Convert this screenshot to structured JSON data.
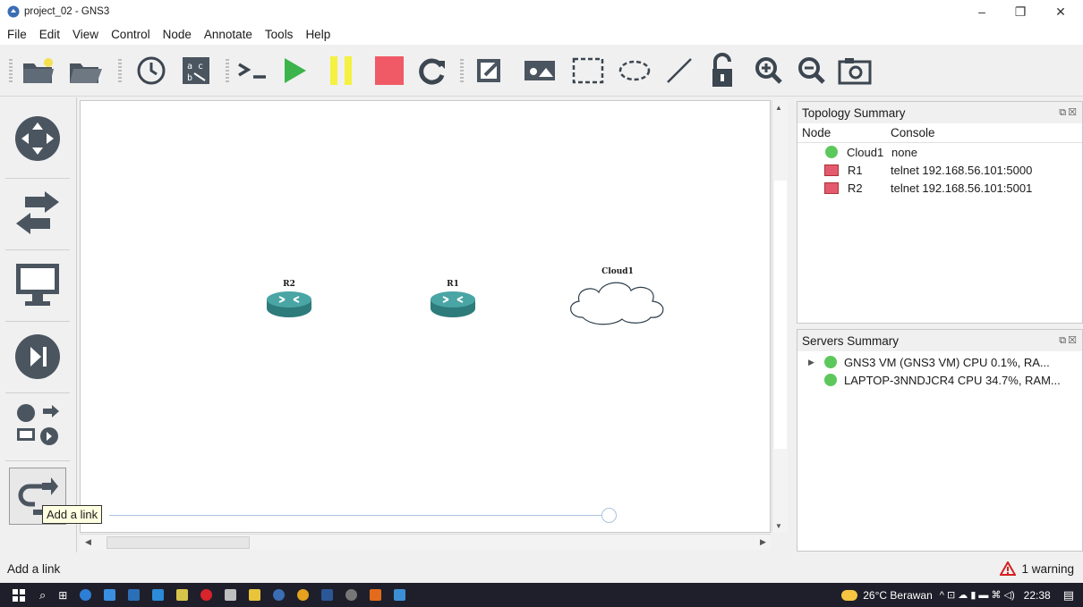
{
  "window": {
    "title": "project_02 - GNS3",
    "minimize": "–",
    "maximize": "❐",
    "close": "✕"
  },
  "menu": [
    "File",
    "Edit",
    "View",
    "Control",
    "Node",
    "Annotate",
    "Tools",
    "Help"
  ],
  "toolbar": {
    "icons": [
      "new-project-icon",
      "open-project-icon",
      "snapshot-icon",
      "show-interface-labels-icon",
      "console-all-icon",
      "start-all-icon",
      "suspend-all-icon",
      "stop-all-icon",
      "reload-all-icon",
      "add-note-icon",
      "insert-picture-icon",
      "draw-rectangle-icon",
      "draw-ellipse-icon",
      "draw-line-icon",
      "unlock-icon",
      "zoom-in-icon",
      "zoom-out-icon",
      "screenshot-icon"
    ]
  },
  "sidebar": {
    "items": [
      "routers-icon",
      "switches-icon",
      "end-devices-icon",
      "security-devices-icon",
      "all-devices-icon",
      "add-link-icon"
    ]
  },
  "topology": {
    "nodes": [
      {
        "name": "R2",
        "type": "router"
      },
      {
        "name": "R1",
        "type": "router"
      },
      {
        "name": "Cloud1",
        "type": "cloud"
      }
    ]
  },
  "tooltip": "Add a link",
  "topology_summary": {
    "title": "Topology Summary",
    "col_node": "Node",
    "col_console": "Console",
    "rows": [
      {
        "node": "Cloud1",
        "console": "none",
        "status": "running"
      },
      {
        "node": "R1",
        "console": "telnet 192.168.56.101:5000",
        "status": "stopped"
      },
      {
        "node": "R2",
        "console": "telnet 192.168.56.101:5001",
        "status": "stopped"
      }
    ]
  },
  "servers_summary": {
    "title": "Servers Summary",
    "rows": [
      {
        "label": "GNS3 VM (GNS3 VM) CPU 0.1%, RA..."
      },
      {
        "label": "LAPTOP-3NNDJCR4 CPU 34.7%, RAM..."
      }
    ]
  },
  "statusbar": {
    "text": "Add a link",
    "warning": "1 warning"
  },
  "taskbar": {
    "weather": "26°C Berawan",
    "time": "22:38",
    "tray": "^ ⊡ ☁ ▮ ▬ ⌘ ◁)"
  },
  "colors": {
    "accent": "#3cb44b",
    "stop": "#f05a67",
    "pause": "#f5f140",
    "router": "#2e8b8b"
  }
}
